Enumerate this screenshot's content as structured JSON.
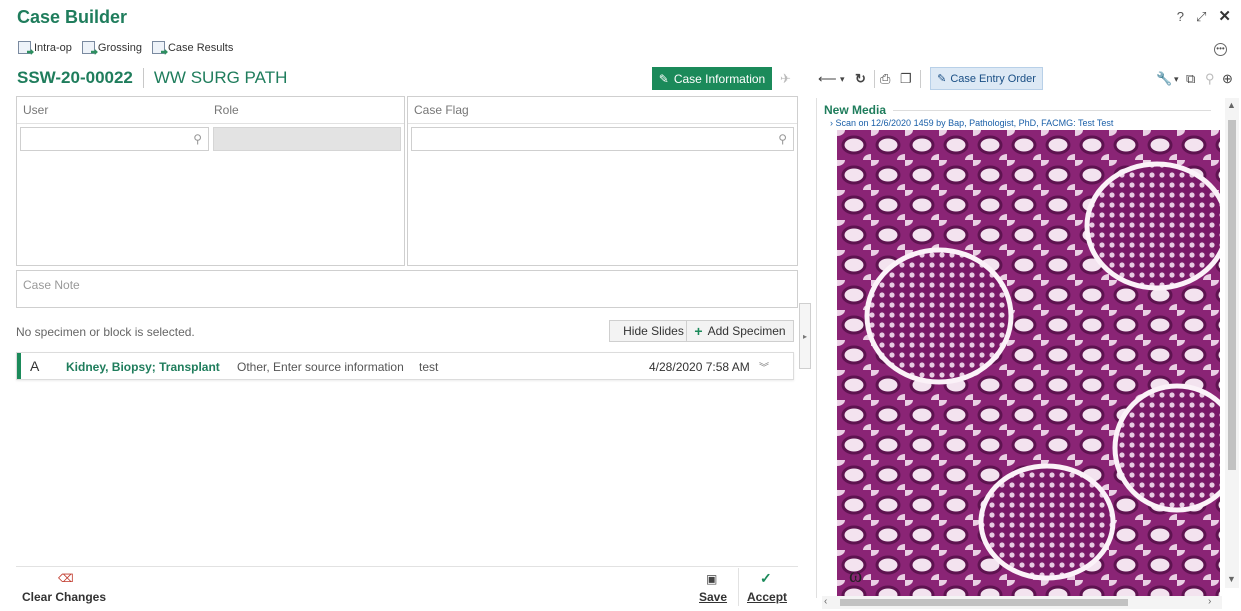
{
  "app": {
    "title": "Case Builder"
  },
  "window_controls": {
    "help": "?",
    "expand": "⤢",
    "close": "✕"
  },
  "toolbar": {
    "items": [
      {
        "label": "Intra-op"
      },
      {
        "label": "Grossing"
      },
      {
        "label": "Case Results"
      }
    ]
  },
  "case": {
    "id": "SSW-20-00022",
    "type": "WW SURG PATH",
    "info_button": "Case Information"
  },
  "users_panel": {
    "col_user": "User",
    "col_role": "Role"
  },
  "flags_panel": {
    "col_flag": "Case Flag"
  },
  "case_note": {
    "placeholder": "Case Note"
  },
  "specimens": {
    "status": "No specimen or block is selected.",
    "hide_slides": "Hide Slides",
    "add_specimen": "Add Specimen",
    "rows": [
      {
        "letter": "A",
        "name": "Kidney, Biopsy; Transplant",
        "source": "Other, Enter source information",
        "note": "test",
        "date": "4/28/2020 7:58 AM"
      }
    ]
  },
  "actions": {
    "clear": "Clear Changes",
    "save": "Save",
    "accept": "Accept"
  },
  "right_panel": {
    "entry_order": "Case Entry Order",
    "media_title": "New Media",
    "scan_link": "Scan on 12/6/2020 1459 by Bap, Pathologist, PhD, FACMG: Test Test"
  },
  "colors": {
    "brand": "#1f7d5c",
    "button": "#1b8a5a",
    "stain": "#8e2878"
  }
}
